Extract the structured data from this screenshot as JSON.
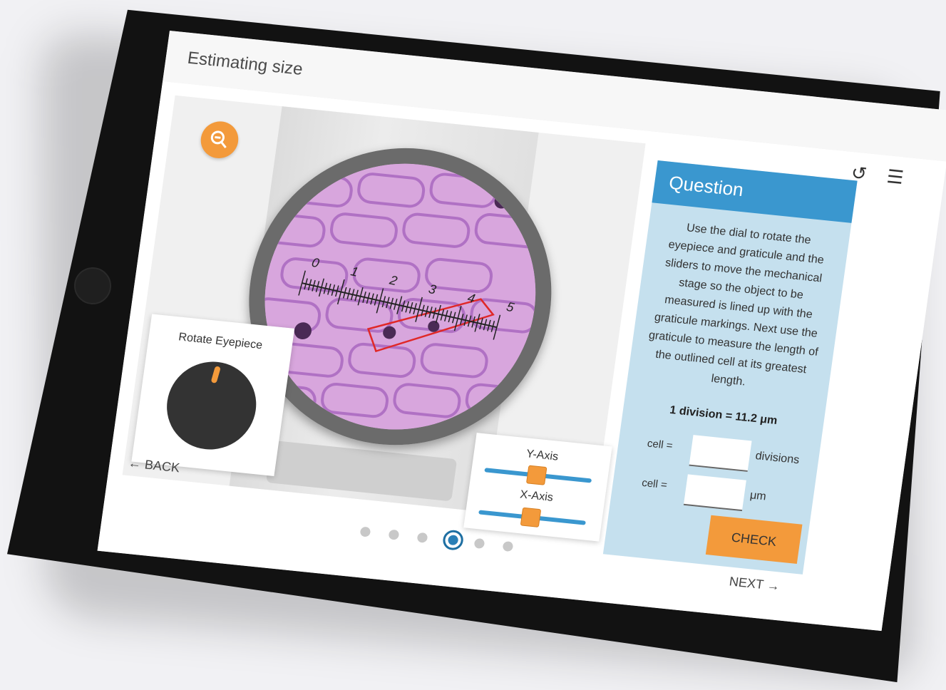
{
  "app": {
    "title": "Estimating size"
  },
  "toolbar": {
    "reset_icon": "reset-icon",
    "menu_icon": "menu-icon"
  },
  "microscope": {
    "zoom_icon": "zoom-out-icon",
    "graticule_ticks": [
      "0",
      "1",
      "2",
      "3",
      "4",
      "5"
    ],
    "outline_color": "#e02828"
  },
  "dial": {
    "label": "Rotate Eyepiece"
  },
  "sliders": {
    "y_label": "Y-Axis",
    "x_label": "X-Axis"
  },
  "nav": {
    "back": "← BACK",
    "next": "NEXT →",
    "pages": 6,
    "current_page": 4
  },
  "question": {
    "title": "Question",
    "text": "Use the dial to rotate the eyepiece and graticule and the sliders to move the mechanical stage so the object to be measured is lined up with the graticule markings. Next use the graticule to measure the length of the outlined cell at its greatest length.",
    "division_info": "1 division = 11.2 μm",
    "cell_label": "cell =",
    "cell_divisions_unit": "divisions",
    "cell_um_unit": "μm",
    "cell_divisions_value": "",
    "cell_um_value": "",
    "check_label": "CHECK"
  },
  "colors": {
    "accent": "#f39a3b",
    "primary": "#3a97cf",
    "panel": "#c5e0ee"
  }
}
